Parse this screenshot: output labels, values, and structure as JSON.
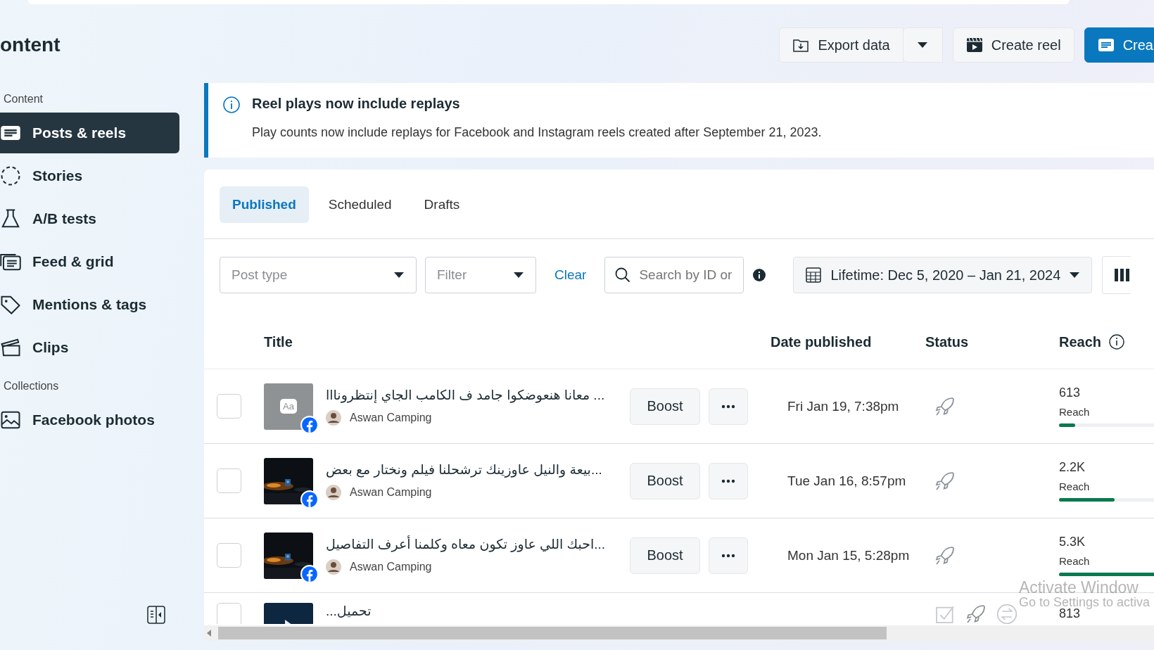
{
  "page_title": "ontent",
  "header_buttons": [
    {
      "kind": "export",
      "label": "Export data"
    },
    {
      "kind": "reel",
      "label": "Create reel"
    },
    {
      "kind": "create",
      "label": "Crea"
    }
  ],
  "sidebar": {
    "sections": [
      {
        "heading": "Content",
        "items": [
          {
            "label": "Posts & reels",
            "selected": true
          },
          {
            "label": "Stories",
            "selected": false
          },
          {
            "label": "A/B tests",
            "selected": false
          },
          {
            "label": "Feed & grid",
            "selected": false
          },
          {
            "label": "Mentions & tags",
            "selected": false
          },
          {
            "label": "Clips",
            "selected": false
          }
        ]
      },
      {
        "heading": "Collections",
        "items": [
          {
            "label": "Facebook photos",
            "selected": false
          }
        ]
      }
    ]
  },
  "banner": {
    "title": "Reel plays now include replays",
    "text": "Play counts now include replays for Facebook and Instagram reels created after September 21, 2023."
  },
  "tabs": [
    {
      "label": "Published",
      "selected": true
    },
    {
      "label": "Scheduled",
      "selected": false
    },
    {
      "label": "Drafts",
      "selected": false
    }
  ],
  "filters": {
    "post_type": {
      "placeholder": "Post type"
    },
    "filter": {
      "placeholder": "Filter"
    },
    "clear": "Clear",
    "search": {
      "placeholder": "Search by ID or"
    },
    "date_range": "Lifetime: Dec 5, 2020 – Jan 21, 2024"
  },
  "table": {
    "columns": [
      "Title",
      "Date published",
      "Status",
      "Reach"
    ],
    "rows": [
      {
        "thumbnail": {
          "kind": "text",
          "label": "Aa"
        },
        "title": "... معانا هنعوضكوا جامد ف الكامب الجاي إنتظرونااا",
        "page": "Aswan Camping",
        "boost": "Boost",
        "date": "Fri Jan 19, 7:38pm",
        "kind": "post",
        "reach": "613",
        "reach_label": "Reach",
        "level": 0.13,
        "checked": false
      },
      {
        "title": "...بيعة والنيل عاوزينك ترشحلنا فيلم ونختار مع بعض",
        "page": "Aswan Camping",
        "boost": "Boost",
        "date": "Tue Jan 16, 8:57pm",
        "kind": "post",
        "reach": "2.2K",
        "reach_label": "Reach",
        "level": 0.44,
        "checked": false
      },
      {
        "title": "...احبك اللي عاوز تكون معاه وكلمنا أعرف التفاصيل",
        "page": "Aswan Camping",
        "boost": "Boost",
        "date": "Mon Jan 15, 5:28pm",
        "kind": "post",
        "reach": "5.3K",
        "reach_label": "Reach",
        "level": 0.9,
        "checked": false
      },
      {
        "thumbnail": {
          "kind": "video"
        },
        "title": "تحميل...",
        "kind": "processing",
        "reach": "813",
        "checked": false
      }
    ]
  },
  "system_notice": {
    "title": "Activate Window",
    "text": "Go to Settings to activa"
  }
}
